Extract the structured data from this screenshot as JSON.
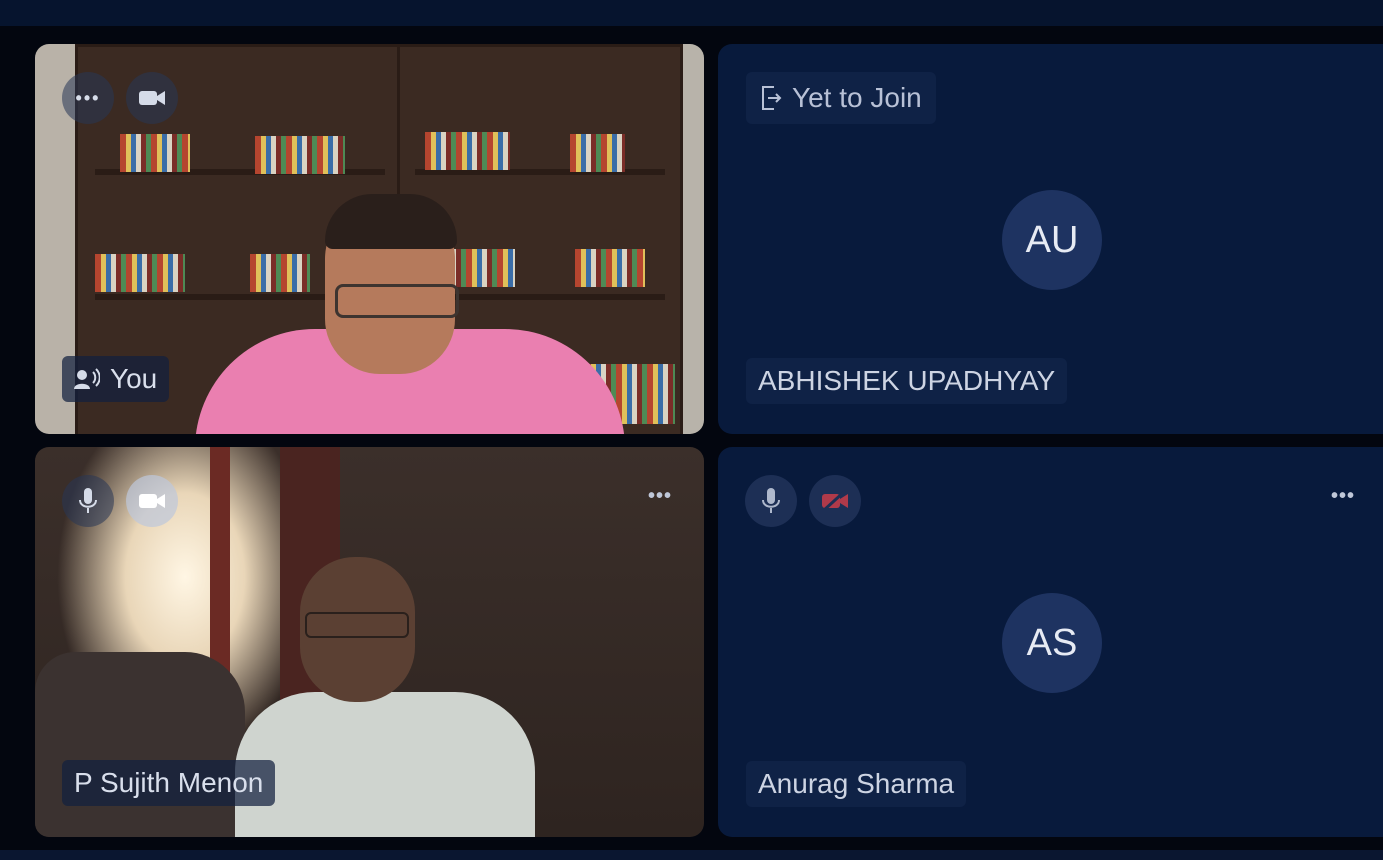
{
  "participants": [
    {
      "id": "self",
      "name": "You",
      "has_video": true,
      "controls": [
        "more-options",
        "video-camera"
      ],
      "speaker_indicator": "speaking-icon"
    },
    {
      "id": "abhishek",
      "name": "ABHISHEK UPADHYAY",
      "initials": "AU",
      "status": "Yet to Join",
      "has_video": false
    },
    {
      "id": "sujith",
      "name": "P Sujith Menon",
      "has_video": true,
      "controls": [
        "microphone",
        "video-camera",
        "more-options"
      ]
    },
    {
      "id": "anurag",
      "name": "Anurag Sharma",
      "initials": "AS",
      "has_video": false,
      "controls": [
        "microphone",
        "video-camera-off",
        "more-options"
      ],
      "video_off_color": "#b03a4a"
    }
  ],
  "colors": {
    "background": "#03060f",
    "tile": "#081a3c",
    "avatar": "#1e3361"
  }
}
